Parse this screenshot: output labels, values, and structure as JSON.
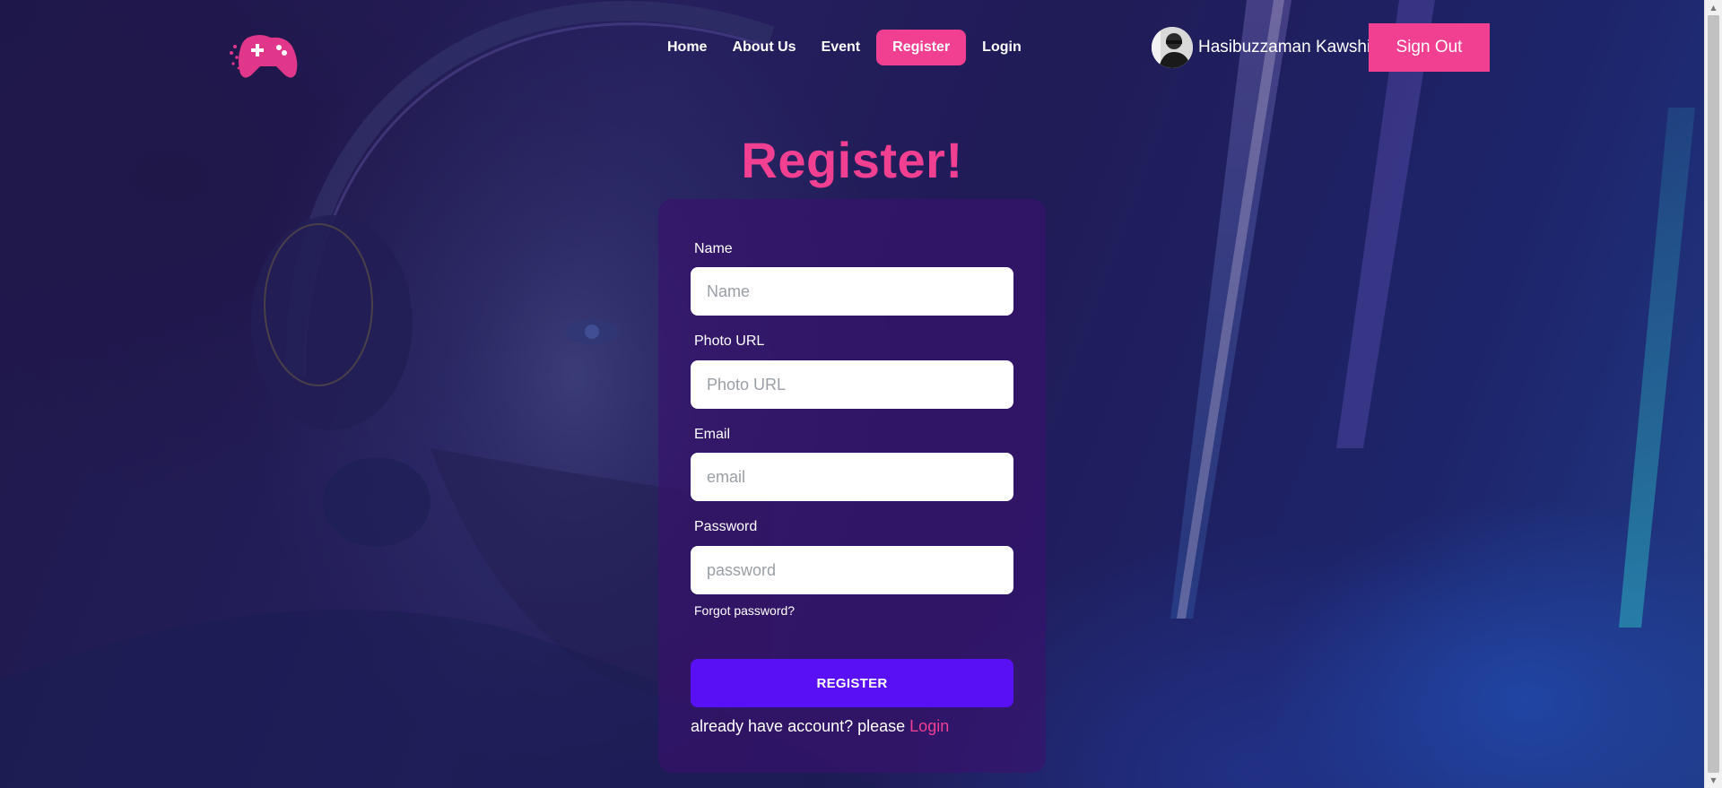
{
  "brand": {
    "logo_icon": "gamepad-logo-icon",
    "accent": "#f13f91",
    "primary": "#5a10f5"
  },
  "nav": {
    "items": [
      {
        "label": "Home",
        "active": false
      },
      {
        "label": "About Us",
        "active": false
      },
      {
        "label": "Event",
        "active": false
      },
      {
        "label": "Register",
        "active": true
      },
      {
        "label": "Login",
        "active": false
      }
    ]
  },
  "user": {
    "name": "Hasibuzzaman Kawshik",
    "avatar_icon": "user-avatar"
  },
  "signout_label": "Sign Out",
  "page": {
    "title": "Register!"
  },
  "form": {
    "name": {
      "label": "Name",
      "placeholder": "Name",
      "value": ""
    },
    "photo": {
      "label": "Photo URL",
      "placeholder": "Photo URL",
      "value": ""
    },
    "email": {
      "label": "Email",
      "placeholder": "email",
      "value": ""
    },
    "password": {
      "label": "Password",
      "placeholder": "password",
      "value": ""
    },
    "forgot_label": "Forgot password?",
    "submit_label": "REGISTER",
    "footer_text": "already have account? please ",
    "footer_link": "Login"
  }
}
